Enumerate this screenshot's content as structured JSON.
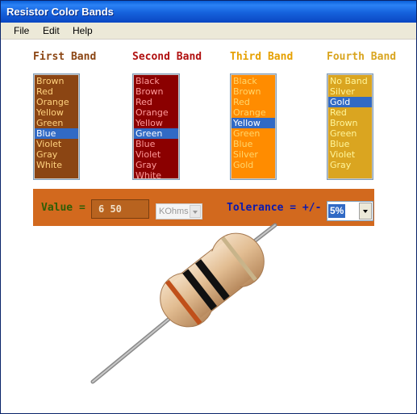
{
  "window": {
    "title": "Resistor Color Bands"
  },
  "menu": [
    "File",
    "Edit",
    "Help"
  ],
  "bands": [
    {
      "title": "First Band",
      "title_color": "#8b4513",
      "bg": "#8b4513",
      "text_color": "#ffd27f",
      "items": [
        "Brown",
        "Red",
        "Orange",
        "Yellow",
        "Green",
        "Blue",
        "Violet",
        "Gray",
        "White"
      ],
      "selected": "Blue"
    },
    {
      "title": "Second Band",
      "title_color": "#b01010",
      "bg": "#8b0000",
      "text_color": "#ff9a9a",
      "items": [
        "Black",
        "Brown",
        "Red",
        "Orange",
        "Yellow",
        "Green",
        "Blue",
        "Violet",
        "Gray",
        "White"
      ],
      "selected": "Green"
    },
    {
      "title": "Third Band",
      "title_color": "#e6a000",
      "bg": "#ff8c00",
      "text_color": "#ffd66b",
      "items": [
        "Black",
        "Brown",
        "Red",
        "Orange",
        "Yellow",
        "Green",
        "Blue",
        "Silver",
        "Gold"
      ],
      "selected": "Yellow"
    },
    {
      "title": "Fourth Band",
      "title_color": "#d9a520",
      "bg": "#daa520",
      "text_color": "#fff59a",
      "items": [
        "No Band",
        "Silver",
        "Gold",
        "Red",
        "Brown",
        "Green",
        "Blue",
        "Violet",
        "Gray"
      ],
      "selected": "Gold"
    }
  ],
  "value": {
    "label": "Value =",
    "display": "6 50",
    "unit": "KOhms"
  },
  "tolerance": {
    "label": "Tolerance = +/-",
    "selected": "5%"
  },
  "colors": {
    "panel": "#d2691e",
    "selection": "#316ac5",
    "titlebar": "#1561dc"
  },
  "icons": {
    "unit_dropdown": "chevron-down-icon",
    "tolerance_dropdown": "chevron-down-icon",
    "resistor": "resistor-image"
  }
}
